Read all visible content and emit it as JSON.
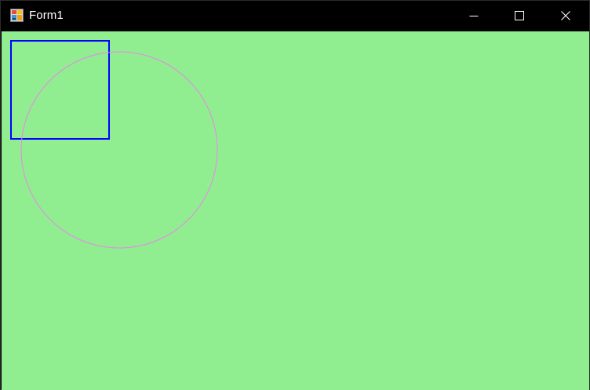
{
  "window": {
    "title": "Form1",
    "app_icon": "windows-forms-app-icon",
    "caption_buttons": {
      "minimize_icon": "minimize-icon",
      "maximize_icon": "maximize-icon",
      "close_icon": "close-icon"
    }
  },
  "colors": {
    "titlebar_background": "#000000",
    "title_text": "#ffffff",
    "client_background": "#90ee90",
    "square_stroke": "#0000ff",
    "circle_stroke": "#ee82ee"
  },
  "drawing": {
    "shapes": [
      "rectangle",
      "circle"
    ]
  }
}
